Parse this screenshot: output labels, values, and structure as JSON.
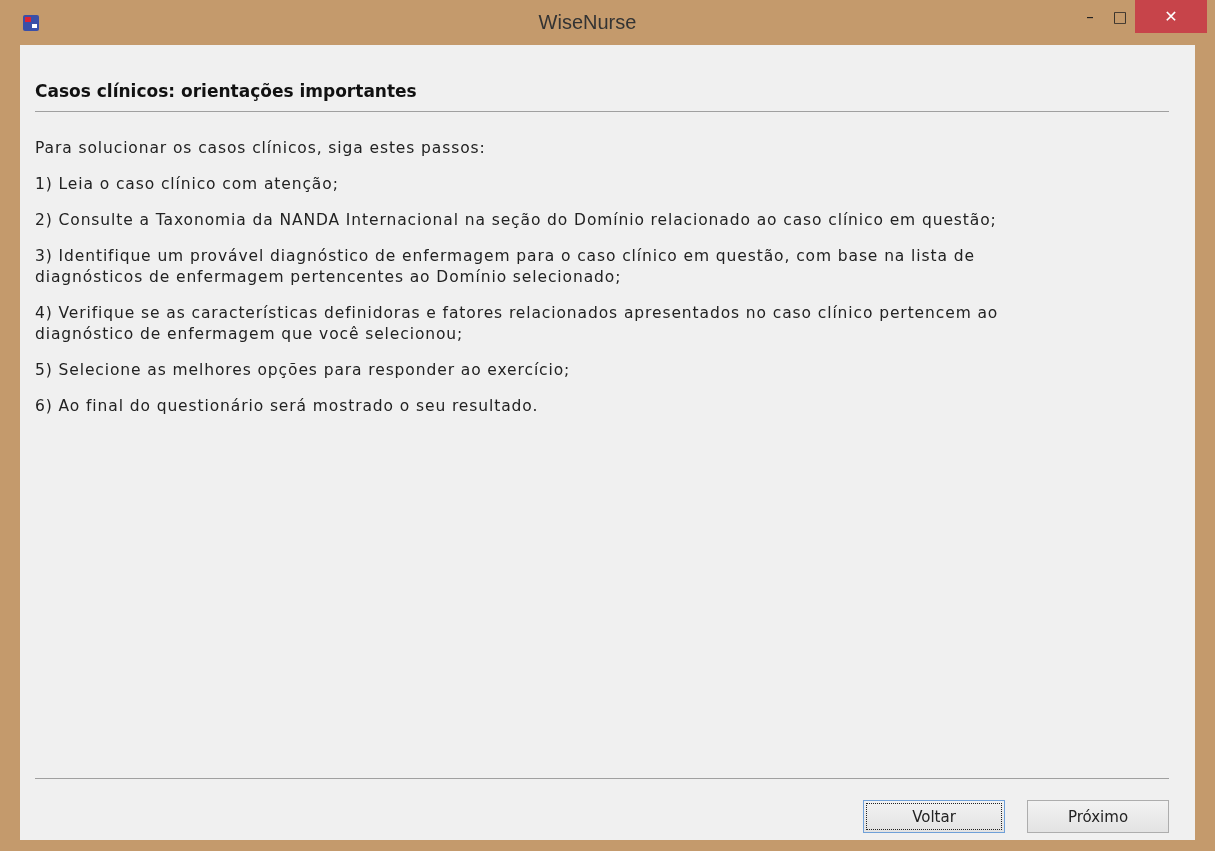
{
  "window": {
    "title": "WiseNurse",
    "controls": [
      "–",
      "□",
      "✕"
    ]
  },
  "heading": "Casos clínicos: orientações importantes",
  "intro": "Para solucionar os casos clínicos, siga estes passos:",
  "steps": [
    {
      "lines": [
        "1) Leia o caso clínico com atenção;"
      ]
    },
    {
      "lines": [
        "2) Consulte a Taxonomia da NANDA Internacional na seção do Domínio relacionado ao caso clínico em questão;"
      ]
    },
    {
      "lines": [
        "3) Identifique um provável diagnóstico de enfermagem para o caso clínico em questão, com base na lista de",
        "diagnósticos de enfermagem pertencentes ao Domínio selecionado;"
      ]
    },
    {
      "lines": [
        "4) Verifique se as características definidoras e fatores relacionados apresentados no caso clínico pertencem ao",
        "diagnóstico de enfermagem que você selecionou;"
      ]
    },
    {
      "lines": [
        "5) Selecione as melhores opções para responder ao exercício;"
      ]
    },
    {
      "lines": [
        "6) Ao final do questionário será mostrado o seu resultado."
      ]
    }
  ],
  "buttons": [
    {
      "label": "Voltar",
      "focused": true
    },
    {
      "label": "Próximo",
      "focused": false
    }
  ]
}
